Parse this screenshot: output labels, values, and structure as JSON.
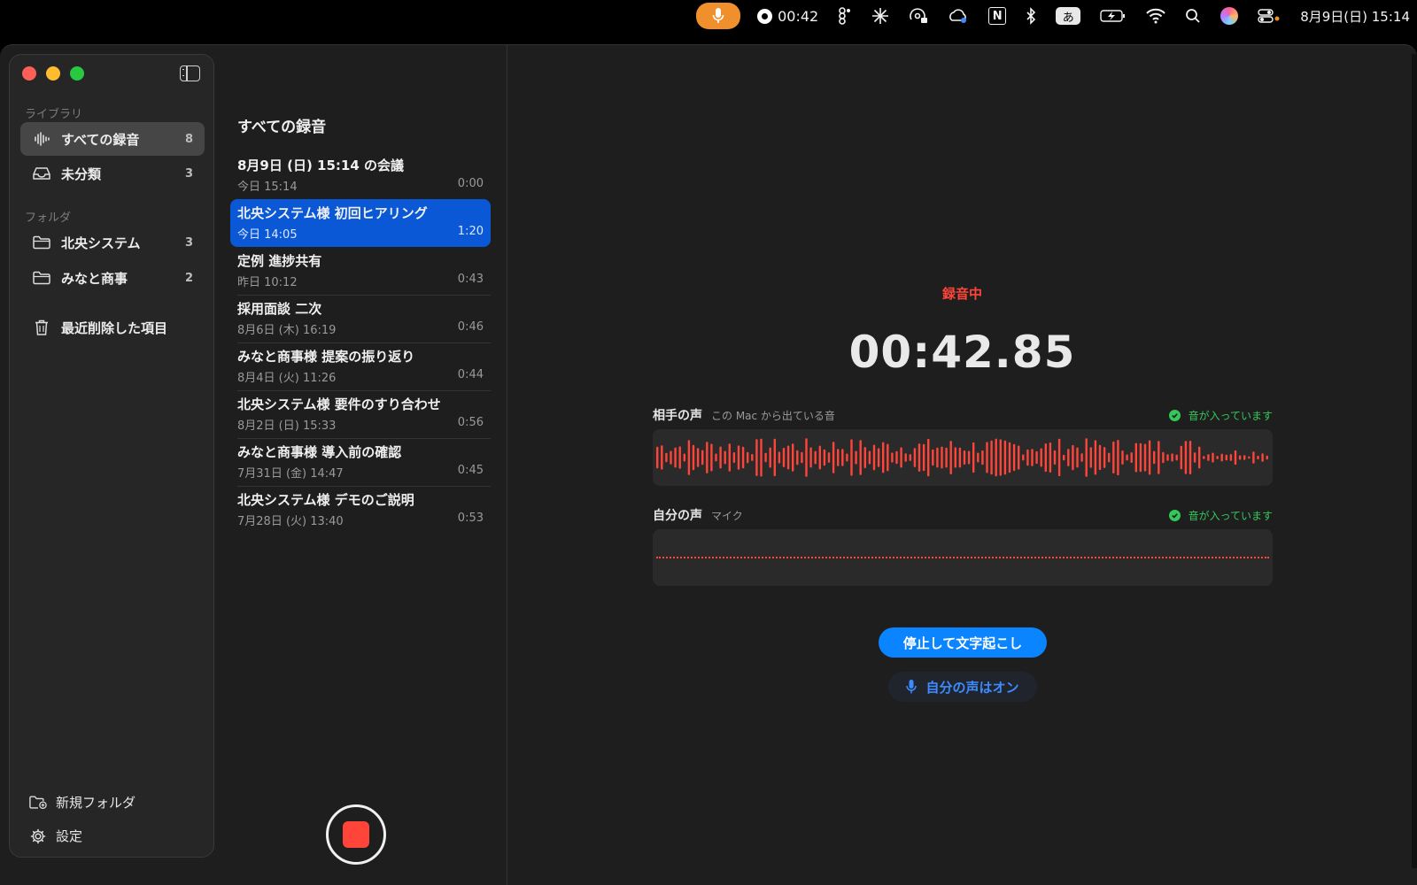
{
  "menubar": {
    "recording_time": "00:42",
    "ime_label": "あ",
    "notion_label": "N",
    "clock": "8月9日(日)  15:14"
  },
  "sidebar": {
    "library_label": "ライブラリ",
    "library_items": [
      {
        "label": "すべての録音",
        "count": "8"
      },
      {
        "label": "未分類",
        "count": "3"
      }
    ],
    "folder_label": "フォルダ",
    "folder_items": [
      {
        "label": "北央システム",
        "count": "3"
      },
      {
        "label": "みなと商事",
        "count": "2"
      }
    ],
    "trash_label": "最近削除した項目",
    "new_folder_label": "新規フォルダ",
    "settings_label": "設定"
  },
  "list": {
    "title": "すべての録音",
    "items": [
      {
        "title": "8月9日 (日) 15:14 の会議",
        "date": "今日 15:14",
        "duration": "0:00"
      },
      {
        "title": "北央システム様 初回ヒアリング",
        "date": "今日 14:05",
        "duration": "1:20"
      },
      {
        "title": "定例 進捗共有",
        "date": "昨日 10:12",
        "duration": "0:43"
      },
      {
        "title": "採用面談 二次",
        "date": "8月6日 (木) 16:19",
        "duration": "0:46"
      },
      {
        "title": "みなと商事様 提案の振り返り",
        "date": "8月4日 (火) 11:26",
        "duration": "0:44"
      },
      {
        "title": "北央システム様 要件のすり合わせ",
        "date": "8月2日 (日) 15:33",
        "duration": "0:56"
      },
      {
        "title": "みなと商事様 導入前の確認",
        "date": "7月31日 (金) 14:47",
        "duration": "0:45"
      },
      {
        "title": "北央システム様 デモのご説明",
        "date": "7月28日 (火) 13:40",
        "duration": "0:53"
      }
    ]
  },
  "main": {
    "status": "録音中",
    "timer": "00:42.85",
    "tracks": [
      {
        "name": "相手の声",
        "sub": "この Mac から出ている音",
        "status": "音が入っています"
      },
      {
        "name": "自分の声",
        "sub": "マイク",
        "status": "音が入っています"
      }
    ],
    "stop_button": "停止して文字起こし",
    "mic_toggle": "自分の声はオン"
  },
  "colors": {
    "accent": "#0a84ff",
    "selection": "#0a58d6",
    "recording_red": "#ff453a",
    "ok_green": "#34c759",
    "menubar_mic": "#f0902c"
  }
}
